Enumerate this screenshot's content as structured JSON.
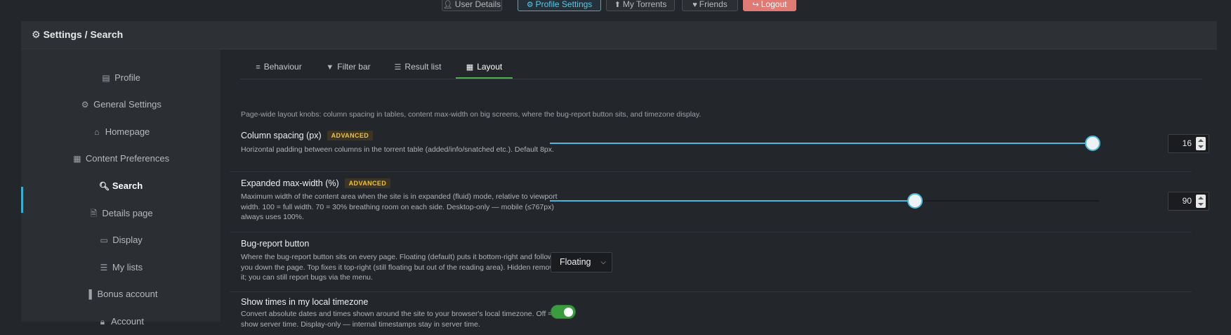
{
  "topnav": {
    "items": [
      {
        "label": "User Details",
        "icon": "user-icon"
      },
      {
        "label": "Profile Settings",
        "icon": "gear-icon",
        "active": true
      },
      {
        "label": "My Torrents",
        "icon": "upload-icon"
      },
      {
        "label": "Friends",
        "icon": "heart-icon"
      },
      {
        "label": "Logout",
        "icon": "logout-icon"
      }
    ]
  },
  "panel": {
    "title": "Settings / Search"
  },
  "sidebar": {
    "items": [
      {
        "label": "Profile",
        "icon": "id-card-icon"
      },
      {
        "label": "General Settings",
        "icon": "gear-icon"
      },
      {
        "label": "Homepage",
        "icon": "home-icon"
      },
      {
        "label": "Content Preferences",
        "icon": "film-icon"
      },
      {
        "label": "Search",
        "icon": "search-icon",
        "active": true
      },
      {
        "label": "Details page",
        "icon": "document-icon"
      },
      {
        "label": "Display",
        "icon": "monitor-icon"
      },
      {
        "label": "My lists",
        "icon": "list-icon"
      },
      {
        "label": "Bonus account",
        "icon": "bar-chart-icon"
      },
      {
        "label": "Account",
        "icon": "lock-icon"
      }
    ]
  },
  "tabs": [
    {
      "label": "Behaviour",
      "icon": "sliders-icon"
    },
    {
      "label": "Filter bar",
      "icon": "filter-icon"
    },
    {
      "label": "Result list",
      "icon": "list-icon"
    },
    {
      "label": "Layout",
      "icon": "grid-icon",
      "active": true
    }
  ],
  "intro": "Page-wide layout knobs: column spacing in tables, content max-width on big screens, where the bug-report button sits, and timezone display.",
  "settings": {
    "column_spacing": {
      "title": "Column spacing (px)",
      "badge": "ADVANCED",
      "desc": "Horizontal padding between columns in the torrent table (added/info/snatched etc.). Default 8px.",
      "value": "16",
      "slider_fraction": 1.0
    },
    "max_width": {
      "title": "Expanded max-width (%)",
      "badge": "ADVANCED",
      "desc": "Maximum width of the content area when the site is in expanded (fluid) mode, relative to viewport width. 100 = full width. 70 = 30% breathing room on each side. Desktop-only — mobile (≤767px) always uses 100%.",
      "value": "90",
      "slider_fraction": 0.665
    },
    "bug_report": {
      "title": "Bug-report button",
      "desc": "Where the bug-report button sits on every page. Floating (default) puts it bottom-right and follows you down the page. Top fixes it top-right (still floating but out of the reading area). Hidden removes it; you can still report bugs via the menu.",
      "selected": "Floating"
    },
    "local_tz": {
      "title": "Show times in my local timezone",
      "desc": "Convert absolute dates and times shown around the site to your browser's local timezone. Off = show server time. Display-only — internal timestamps stay in server time.",
      "enabled": true
    }
  },
  "colors": {
    "accent": "#3ab0cf",
    "tab_underline": "#4caf50",
    "badge": "#f2c23a",
    "logout": "#e07a74",
    "toggle_on": "#3a9c3e"
  }
}
